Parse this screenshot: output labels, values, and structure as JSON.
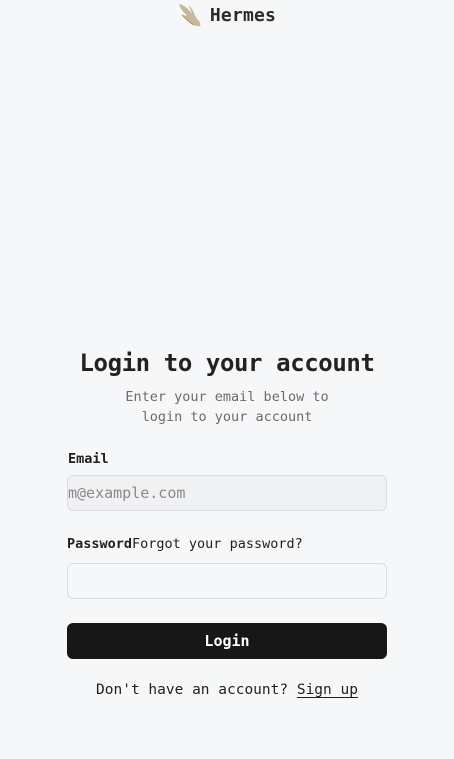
{
  "brand": {
    "name": "Hermes",
    "logo_icon": "winged-sandal-icon",
    "logo_color": "#c8b79a"
  },
  "login": {
    "title": "Login to your account",
    "subtitle": "Enter your email below to login to your account",
    "email_label": "Email",
    "email_placeholder": "m@example.com",
    "email_value": "",
    "password_label": "Password",
    "forgot_password": "Forgot your password?",
    "password_value": "",
    "submit_label": "Login",
    "signup_prompt": "Don't have an account?",
    "signup_link": "Sign up"
  },
  "colors": {
    "background": "#f6f7f9",
    "button": "#171717",
    "button_text": "#ffffff"
  }
}
